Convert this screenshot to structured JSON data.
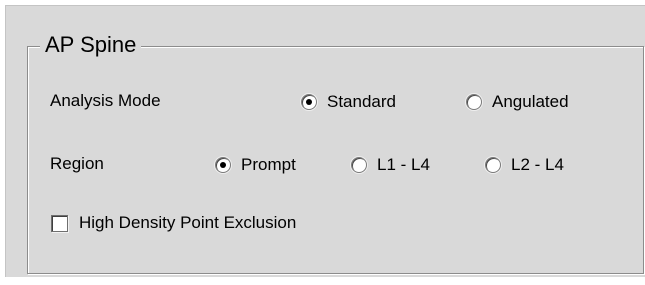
{
  "group": {
    "title": "AP Spine"
  },
  "analysis_mode": {
    "label": "Analysis Mode",
    "options": [
      {
        "label": "Standard",
        "selected": true
      },
      {
        "label": "Angulated",
        "selected": false
      }
    ]
  },
  "region": {
    "label": "Region",
    "options": [
      {
        "label": "Prompt",
        "selected": true
      },
      {
        "label": "L1 - L4",
        "selected": false
      },
      {
        "label": "L2 - L4",
        "selected": false
      }
    ]
  },
  "high_density": {
    "label": "High Density Point Exclusion",
    "checked": false
  },
  "colors": {
    "panel_background": "#d9d9d9",
    "border": "#8c8c8c",
    "text": "#000000"
  }
}
